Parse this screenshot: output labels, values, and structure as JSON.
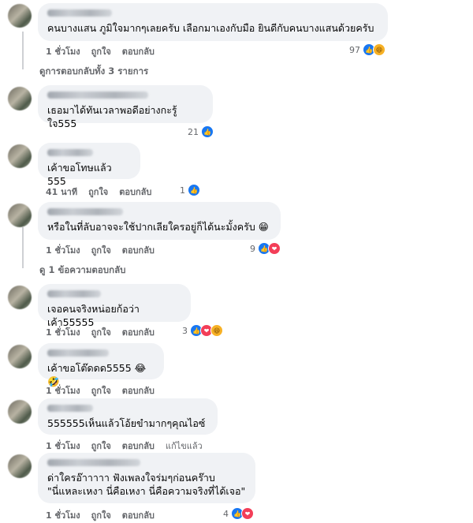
{
  "comments": [
    {
      "text": "คนบางแสน ภูมิใจมากๆเลยครับ เลือกมาเองกับมือ ยินดีกับคนบางแสนด้วยครับ",
      "time": "1 ชั่วโมง",
      "like": "ถูกใจ",
      "reply": "ตอบกลับ",
      "reaction_count": "97",
      "reactions": [
        "like-icon",
        "haha-icon"
      ]
    },
    {
      "text": "เธอมาได้ทันเวลาพอดีอย่างกะรู้ใจ555",
      "time": "",
      "like": "",
      "reply": "",
      "reaction_count": "21",
      "reactions": [
        "like-icon"
      ]
    },
    {
      "text": "เค้าขอโทษแล้ว 555",
      "time": "41 นาที",
      "like": "ถูกใจ",
      "reply": "ตอบกลับ",
      "reaction_count": "1",
      "reactions": [
        "like-icon"
      ]
    },
    {
      "text": "หรือในที่ลับอาจจะใช้ปากเลียใครอยู่ก็ได้นะมั้งครับ 😁",
      "time": "1 ชั่วโมง",
      "like": "ถูกใจ",
      "reply": "ตอบกลับ",
      "reaction_count": "9",
      "reactions": [
        "like-icon",
        "love-icon"
      ]
    },
    {
      "text": "เจอคนจริงหน่อยก้อว่าเค้า55555",
      "time": "1 ชั่วโมง",
      "like": "ถูกใจ",
      "reply": "ตอบกลับ",
      "reaction_count": "3",
      "reactions": [
        "like-icon",
        "love-icon",
        "haha-icon"
      ]
    },
    {
      "text": "เค้าขอโต๊ดดด5555 😂🤣",
      "time": "1 ชั่วโมง",
      "like": "ถูกใจ",
      "reply": "ตอบกลับ",
      "reaction_count": "",
      "reactions": []
    },
    {
      "text": "555555เห็นแล้วโอ้ยขำมากๆคุณไอซ์",
      "time": "1 ชั่วโมง",
      "like": "ถูกใจ",
      "reply": "ตอบกลับ",
      "edited": "แก้ไขแล้ว",
      "reaction_count": "",
      "reactions": []
    },
    {
      "text": "ด่าใครอ๊าาาาา ฟังเพลงใจร่มๆก่อนคร๊าบ\n\"นี่แหละเหงา นี่คือเหงา นี่คือความจริงที่ได้เจอ\"",
      "time": "1 ชั่วโมง",
      "like": "ถูกใจ",
      "reply": "ตอบกลับ",
      "reaction_count": "4",
      "reactions": [
        "like-icon",
        "love-icon"
      ]
    }
  ],
  "view_replies_1": "ดูการตอบกลับทั้ง 3 รายการ",
  "view_replies_2": "ดู 1 ข้อความตอบกลับ"
}
